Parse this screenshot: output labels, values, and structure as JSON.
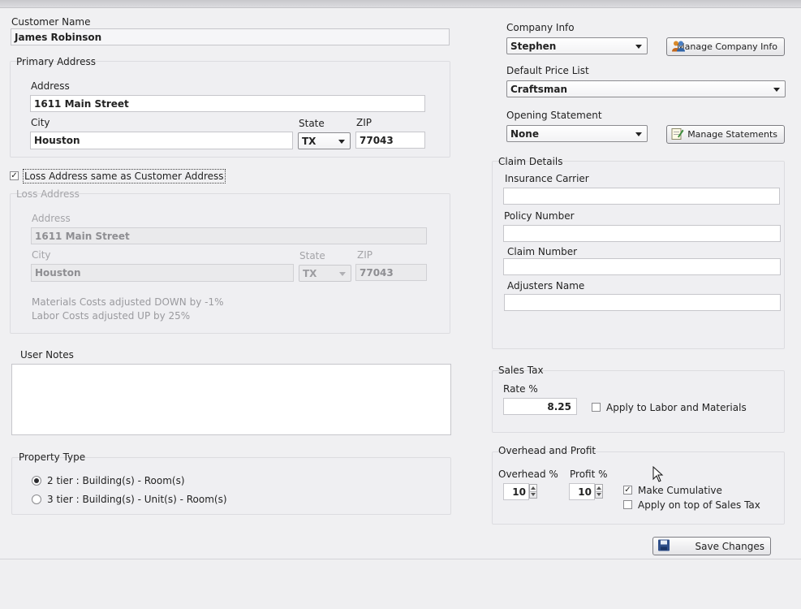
{
  "customer": {
    "name_label": "Customer Name",
    "name_value": "James Robinson"
  },
  "primary_address": {
    "group_label": "Primary Address",
    "address_label": "Address",
    "address_value": "1611 Main Street",
    "city_label": "City",
    "city_value": "Houston",
    "state_label": "State",
    "state_value": "TX",
    "zip_label": "ZIP",
    "zip_value": "77043"
  },
  "loss_same_checkbox": {
    "label": "Loss Address same as Customer Address",
    "checked": true
  },
  "loss_address": {
    "group_label": "Loss Address",
    "address_label": "Address",
    "address_value": "1611 Main Street",
    "city_label": "City",
    "city_value": "Houston",
    "state_label": "State",
    "state_value": "TX",
    "zip_label": "ZIP",
    "zip_value": "77043",
    "materials_note": "Materials Costs adjusted DOWN by -1%",
    "labor_note": "Labor Costs adjusted UP by 25%"
  },
  "user_notes": {
    "label": "User Notes",
    "value": ""
  },
  "property_type": {
    "group_label": "Property Type",
    "option_2tier": "2 tier : Building(s) - Room(s)",
    "option_3tier": "3 tier : Building(s) - Unit(s) -  Room(s)",
    "selected": "2 tier"
  },
  "company_info": {
    "label": "Company Info",
    "value": "Stephen",
    "manage_button": "Manage Company Info"
  },
  "price_list": {
    "label": "Default Price List",
    "value": "Craftsman"
  },
  "opening_statement": {
    "label": "Opening Statement",
    "value": "None",
    "manage_button": "Manage Statements"
  },
  "claim_details": {
    "group_label": "Claim Details",
    "insurance_carrier_label": "Insurance Carrier",
    "insurance_carrier_value": "",
    "policy_number_label": "Policy Number",
    "policy_number_value": "",
    "claim_number_label": "Claim Number",
    "claim_number_value": "",
    "adjusters_name_label": "Adjusters Name",
    "adjusters_name_value": ""
  },
  "sales_tax": {
    "group_label": "Sales Tax",
    "rate_label": "Rate %",
    "rate_value": "8.25",
    "apply_label": "Apply to Labor and Materials",
    "apply_checked": false
  },
  "overhead_profit": {
    "group_label": "Overhead and Profit",
    "overhead_label": "Overhead %",
    "overhead_value": "10",
    "profit_label": "Profit %",
    "profit_value": "10",
    "cumulative_label": "Make Cumulative",
    "cumulative_checked": true,
    "on_top_label": "Apply on top of Sales Tax",
    "on_top_checked": false
  },
  "save_button": "Save Changes",
  "icons": {
    "company": "people-icon",
    "statements": "note-edit-icon",
    "save": "floppy-disk-icon"
  }
}
